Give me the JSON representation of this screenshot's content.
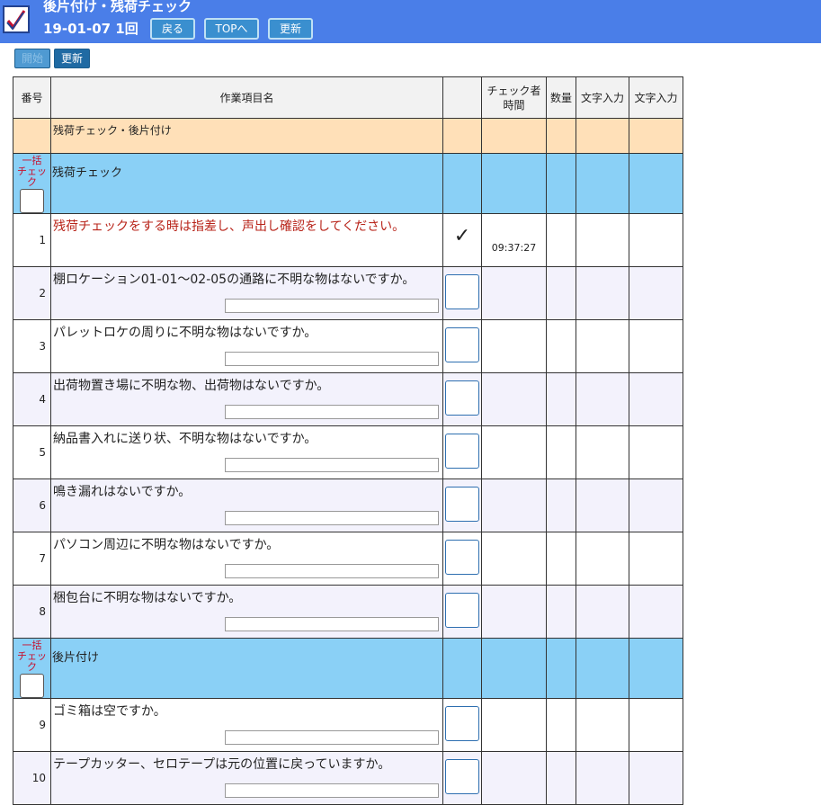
{
  "header": {
    "title": "後片付け・残荷チェック",
    "subtitle": "19-01-07 1回",
    "buttons": {
      "back": "戻る",
      "top": "TOPへ",
      "refresh": "更新"
    }
  },
  "toolbar": {
    "disabled_label": "開始",
    "update_label": "更新"
  },
  "table": {
    "headers": {
      "number": "番号",
      "name": "作業項目名",
      "check_line1": "チェック者",
      "check_line2": "時間",
      "qty": "数量",
      "text1": "文字入力",
      "text2": "文字入力"
    },
    "section_title": "残荷チェック・後片付け",
    "bulk_label_line1": "一括",
    "bulk_label_line2": "チェック",
    "groups": [
      {
        "name": "残荷チェック",
        "items": [
          {
            "no": "1",
            "text": "残荷チェックをする時は指差し、声出し確認をしてください。",
            "checked": true,
            "time": "09:37:27"
          },
          {
            "no": "2",
            "text": "棚ロケーション01-01～02-05の通路に不明な物はないですか。"
          },
          {
            "no": "3",
            "text": "パレットロケの周りに不明な物はないですか。"
          },
          {
            "no": "4",
            "text": "出荷物置き場に不明な物、出荷物はないですか。"
          },
          {
            "no": "5",
            "text": "納品書入れに送り状、不明な物はないですか。"
          },
          {
            "no": "6",
            "text": "鳴き漏れはないですか。"
          },
          {
            "no": "7",
            "text": "パソコン周辺に不明な物はないですか。"
          },
          {
            "no": "8",
            "text": "梱包台に不明な物はないですか。"
          }
        ]
      },
      {
        "name": "後片付け",
        "items": [
          {
            "no": "9",
            "text": "ゴミ箱は空ですか。"
          },
          {
            "no": "10",
            "text": "テープカッター、セロテープは元の位置に戻っていますか。"
          }
        ]
      }
    ],
    "checkmark_glyph": "✓"
  }
}
